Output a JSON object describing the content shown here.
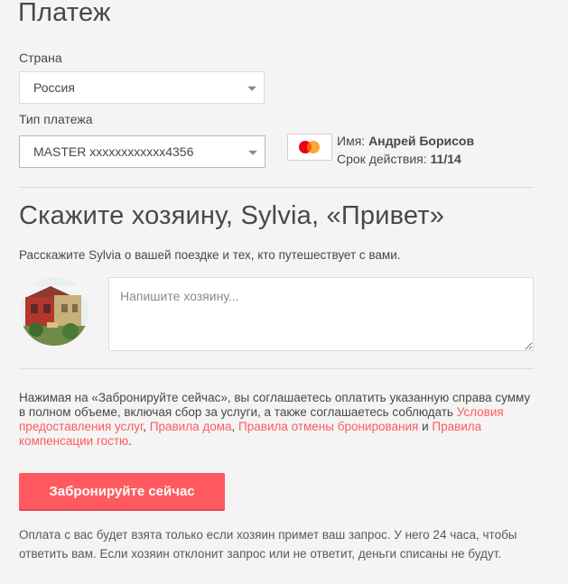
{
  "payment": {
    "title": "Платеж",
    "country_label": "Страна",
    "country_value": "Россия",
    "type_label": "Тип платежа",
    "type_value": "MASTER xxxxxxxxxxxx4356",
    "card": {
      "icon": "mastercard-icon",
      "name_label": "Имя:",
      "name_value": "Андрей Борисов",
      "expiry_label": "Срок действия:",
      "expiry_value": "11/14"
    }
  },
  "host_message": {
    "title": "Скажите хозяину, Sylvia, «Привет»",
    "description": "Расскажите Sylvia о вашей поездке и тех, кто путешествует с вами.",
    "placeholder": "Напишите хозяину..."
  },
  "terms": {
    "text_before": "Нажимая на «Забронируйте сейчас», вы соглашаетесь оплатить указанную справа сумму в полном объеме, включая сбор за услуги, а также соглашаетесь соблюдать ",
    "link_service": "Условия предоставления услуг",
    "sep1": ", ",
    "link_house": "Правила дома",
    "sep2": ", ",
    "link_cancel": "Правила отмены бронирования",
    "and": " и ",
    "link_compensation": "Правила компенсации гостю",
    "end": "."
  },
  "book_button": "Забронируйте сейчас",
  "footer_note": "Оплата с вас будет взята только если хозяин примет ваш запрос. У него 24 часа, чтобы ответить вам. Если хозяин отклонит запрос или не ответит, деньги списаны не будут.",
  "colors": {
    "accent": "#ff5a5f",
    "background": "#f4f4f4",
    "text": "#484848"
  }
}
